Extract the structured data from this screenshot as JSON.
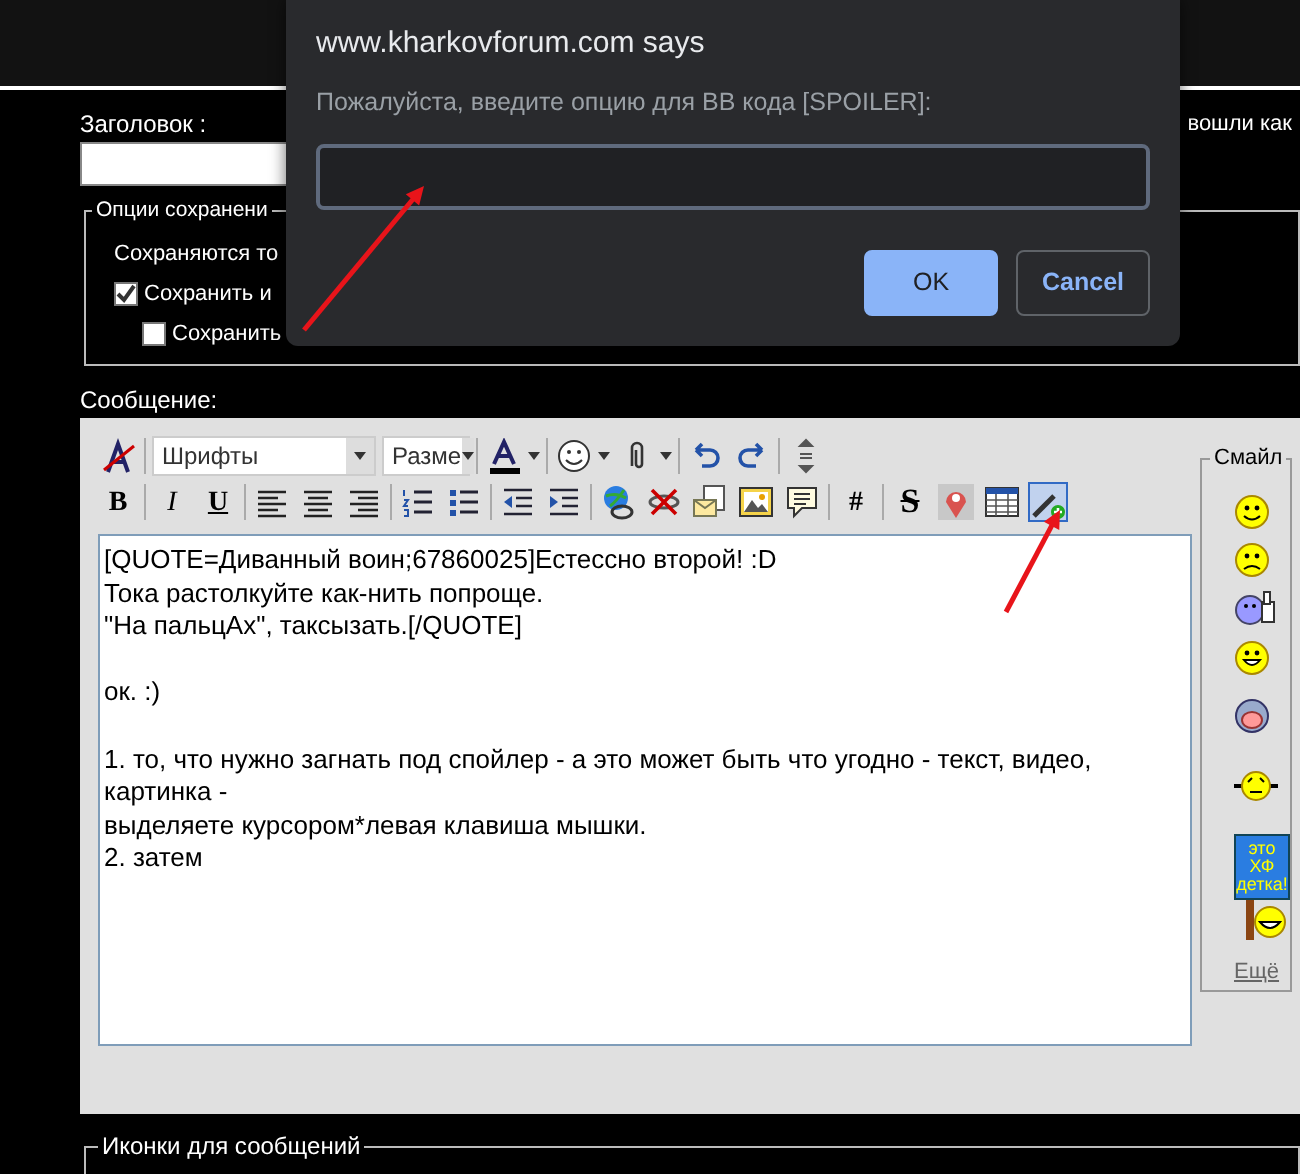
{
  "header": {
    "title_label": "Заголовок :",
    "logged_in_text": "вошли как"
  },
  "save_options": {
    "legend": "Опции сохранени",
    "note": "Сохраняются то",
    "options": [
      {
        "label": "Сохранить и",
        "checked": true
      },
      {
        "label": "Сохранить",
        "checked": false
      }
    ]
  },
  "message": {
    "label": "Сообщение:",
    "toolbar_row_1": [
      {
        "kind": "icon"
      },
      {
        "kind": "select",
        "value": "Шрифты"
      },
      {
        "kind": "select",
        "value": "Разме"
      },
      {
        "kind": "dropdown"
      },
      {
        "kind": "dropdown"
      },
      {
        "kind": "dropdown"
      },
      {
        "kind": "icon"
      },
      {
        "kind": "icon"
      },
      {
        "kind": "icon"
      }
    ],
    "toolbar_row_2": [
      {
        "kind": "text",
        "label": "B"
      },
      {
        "kind": "text",
        "label": "I"
      },
      {
        "kind": "text",
        "label": "U"
      },
      {
        "kind": "icon"
      },
      {
        "kind": "icon"
      },
      {
        "kind": "icon"
      },
      {
        "kind": "icon"
      },
      {
        "kind": "icon"
      },
      {
        "kind": "icon"
      },
      {
        "kind": "icon"
      },
      {
        "kind": "icon"
      },
      {
        "kind": "icon"
      },
      {
        "kind": "icon"
      },
      {
        "kind": "icon"
      },
      {
        "kind": "icon"
      },
      {
        "kind": "text",
        "label": "#"
      },
      {
        "kind": "text",
        "label": "S"
      },
      {
        "kind": "icon"
      },
      {
        "kind": "icon"
      },
      {
        "kind": "icon",
        "highlighted": true
      }
    ],
    "text": "[QUOTE=Диванный воин;67860025]Естессно второй! :D\nТока растолкуйте как-нить попроще.\n\"На пальцАх\", таксызать.[/QUOTE]\n\nок. :)\n\n1. то, что нужно загнать под спойлер - а это может быть что угодно - текст, видео, картинка -\nвыделяете курсором*левая клавиша мышки.\n2. затем ",
    "smilies": {
      "legend": "Смайл",
      "items": [
        {
          "kind": "smile"
        },
        {
          "kind": "frown"
        },
        {
          "kind": "thumbs"
        },
        {
          "kind": "grin"
        },
        {
          "kind": "shout"
        },
        {
          "kind": "wave"
        },
        {
          "kind": "sign",
          "sign_text": "это ХФ детка!"
        }
      ],
      "more_link": "Ещё"
    }
  },
  "icons_section": {
    "legend": "Иконки для сообщений"
  },
  "dialog": {
    "title": "www.kharkovforum.com says",
    "message": "Пожалуйста, введите опцию для BB кода [SPOILER]:",
    "buttons": [
      {
        "label": "OK",
        "kind": "primary"
      },
      {
        "label": "Cancel",
        "kind": "secondary"
      }
    ]
  },
  "annotations": [
    {
      "kind": "arrow"
    },
    {
      "kind": "arrow"
    }
  ]
}
